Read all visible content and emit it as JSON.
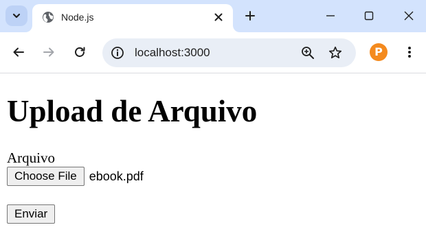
{
  "browser": {
    "tab": {
      "title": "Node.js",
      "favicon_icon": "globe-icon"
    },
    "icons": {
      "tab_search": "chevron-down-icon",
      "tab_close": "close-icon",
      "new_tab": "plus-icon",
      "minimize": "minimize-icon",
      "maximize": "maximize-icon",
      "close_window": "close-icon",
      "back": "back-arrow-icon",
      "forward": "forward-arrow-icon",
      "reload": "reload-icon",
      "site_info": "info-icon",
      "zoom": "zoom-in-icon",
      "bookmark": "star-icon",
      "menu": "more-vertical-icon"
    },
    "address_bar": {
      "url": "localhost:3000"
    },
    "profile": {
      "initial": "P",
      "color": "#f48a1e"
    },
    "colors": {
      "tabstrip_bg": "#d3e3fd",
      "omnibox_bg": "#e9eef6"
    }
  },
  "page": {
    "heading": "Upload de Arquivo",
    "form": {
      "file_label": "Arquivo",
      "choose_file_label": "Choose File",
      "selected_file": "ebook.pdf",
      "submit_label": "Enviar"
    }
  }
}
